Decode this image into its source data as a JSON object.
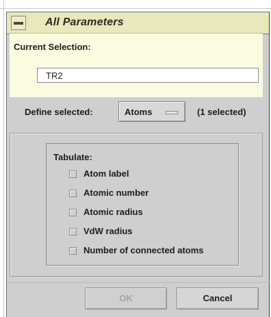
{
  "window": {
    "title": "All Parameters",
    "menu_icon": "window-menu-icon"
  },
  "current_selection": {
    "label": "Current Selection:",
    "value": "TR2"
  },
  "define": {
    "label": "Define selected:",
    "option_value": "Atoms",
    "count_text": "(1 selected)"
  },
  "tabulate": {
    "title": "Tabulate:",
    "options": [
      {
        "label": "Atom label",
        "checked": false
      },
      {
        "label": "Atomic number",
        "checked": false
      },
      {
        "label": "Atomic radius",
        "checked": false
      },
      {
        "label": "VdW radius",
        "checked": false
      },
      {
        "label": "Number of connected atoms",
        "checked": false
      }
    ]
  },
  "buttons": {
    "ok_label": "OK",
    "ok_enabled": false,
    "cancel_label": "Cancel"
  },
  "colors": {
    "titlebar": "#e8e8bc",
    "selection_panel": "#fbfbe0",
    "window": "#cfcfcf"
  }
}
